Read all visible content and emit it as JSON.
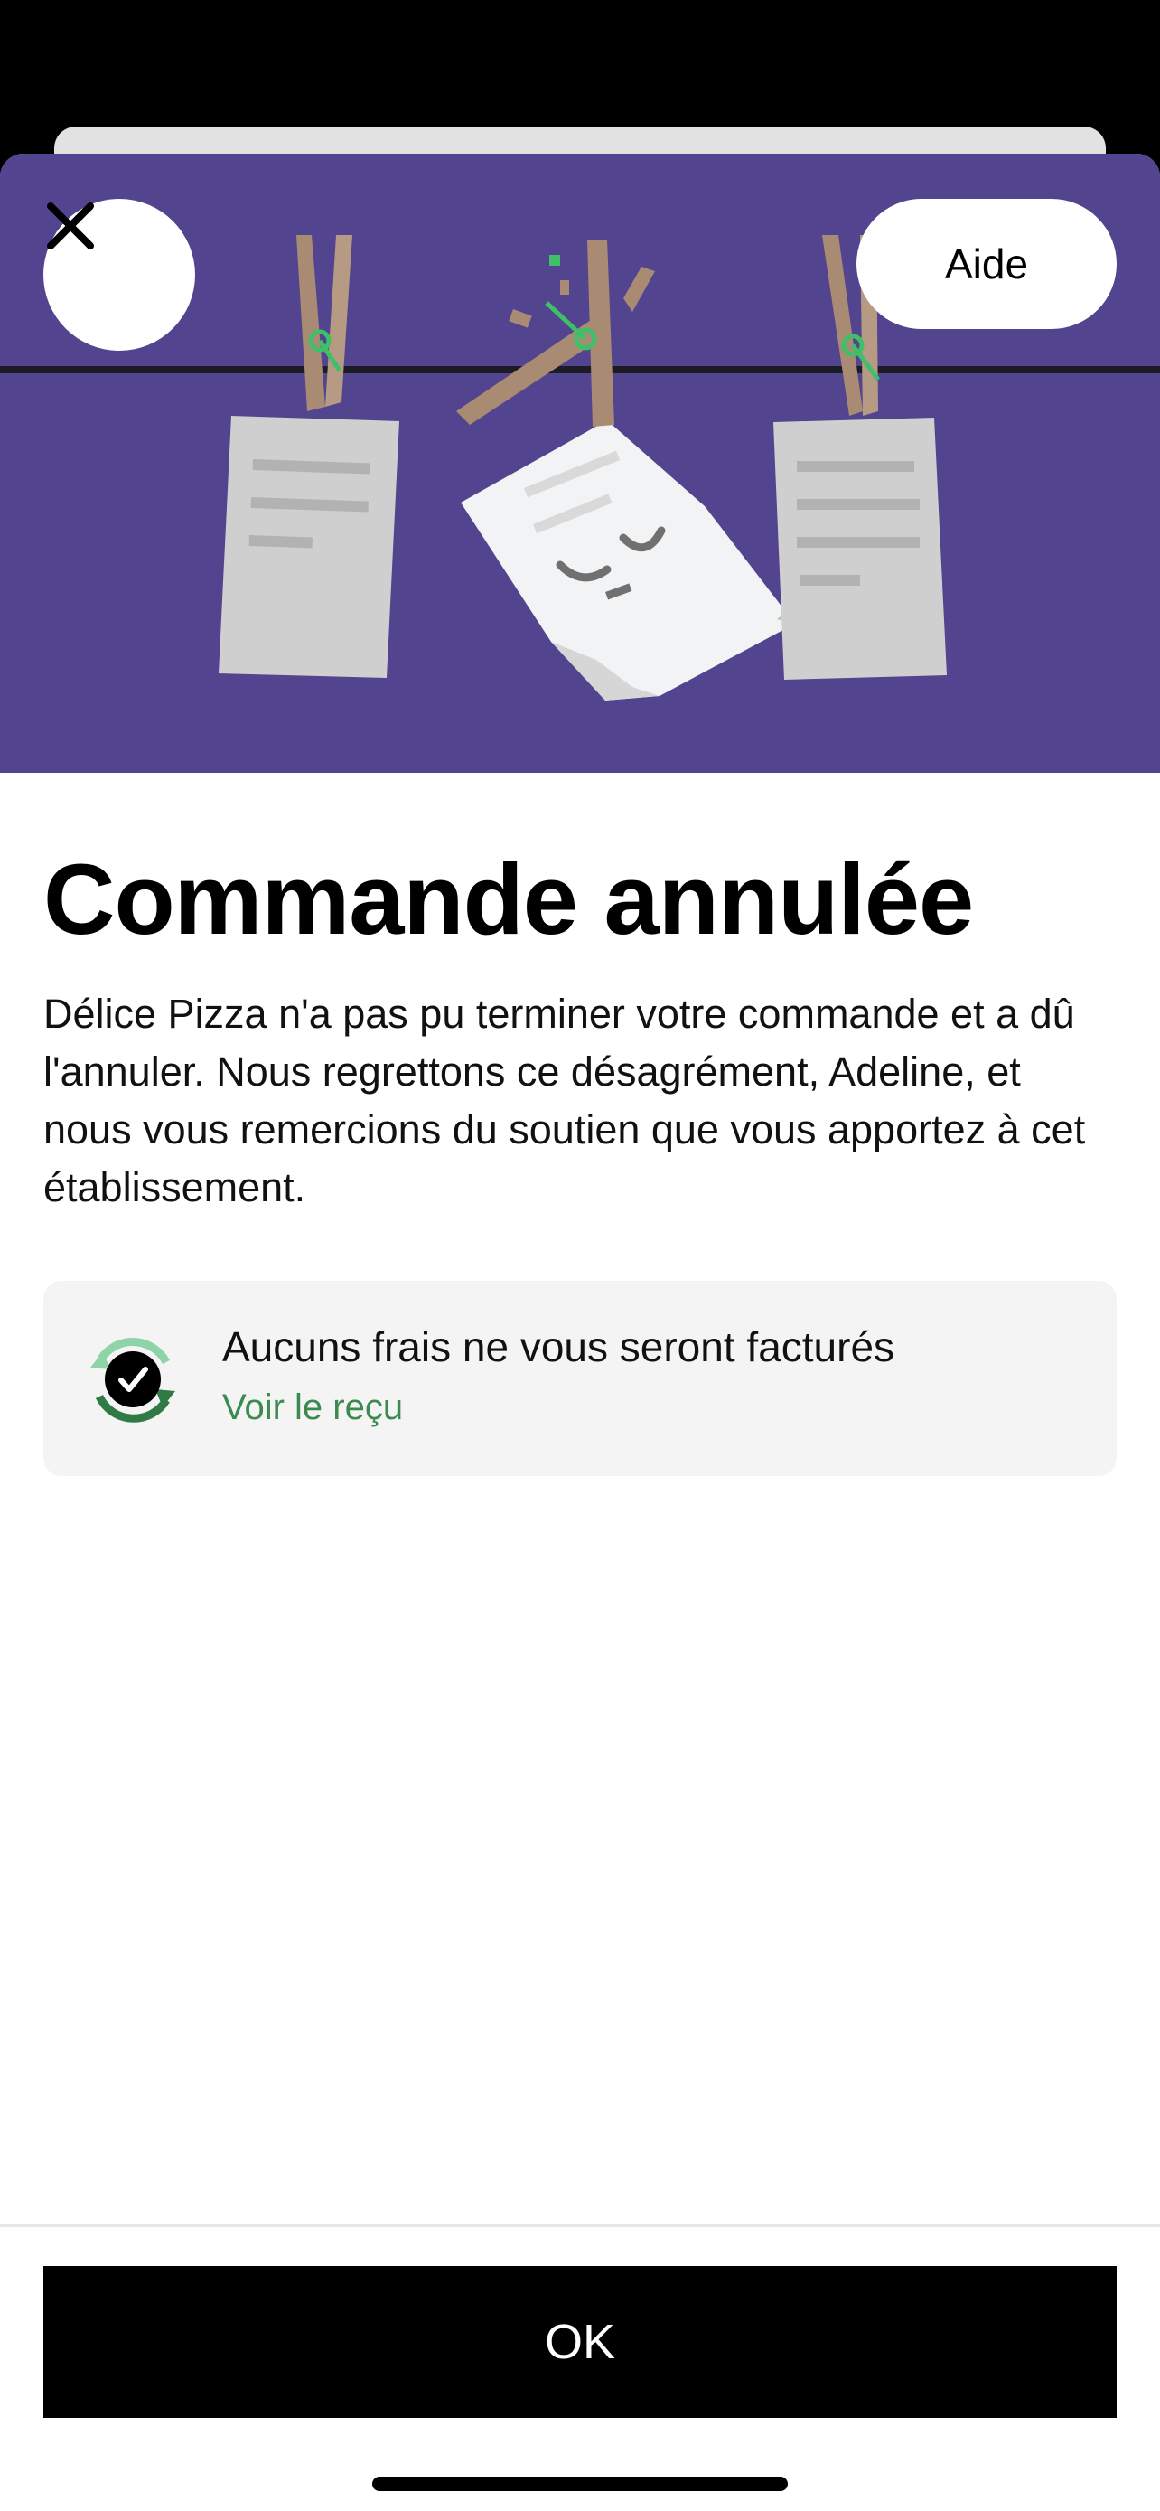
{
  "header": {
    "help_label": "Aide"
  },
  "main": {
    "title": "Commande annulée",
    "message": "Délice Pizza n'a pas pu terminer votre commande et a dû l'annuler. Nous regrettons ce désagrément, Adeline, et nous vous remercions du soutien que vous apportez à cet établissement."
  },
  "info_card": {
    "title": "Aucuns frais ne vous seront facturés",
    "link": "Voir le reçu",
    "icon": "check-circle-icon"
  },
  "footer": {
    "ok_label": "OK"
  },
  "colors": {
    "hero_background": "#53448f",
    "link_green": "#3d8a50",
    "primary_button": "#000000"
  }
}
